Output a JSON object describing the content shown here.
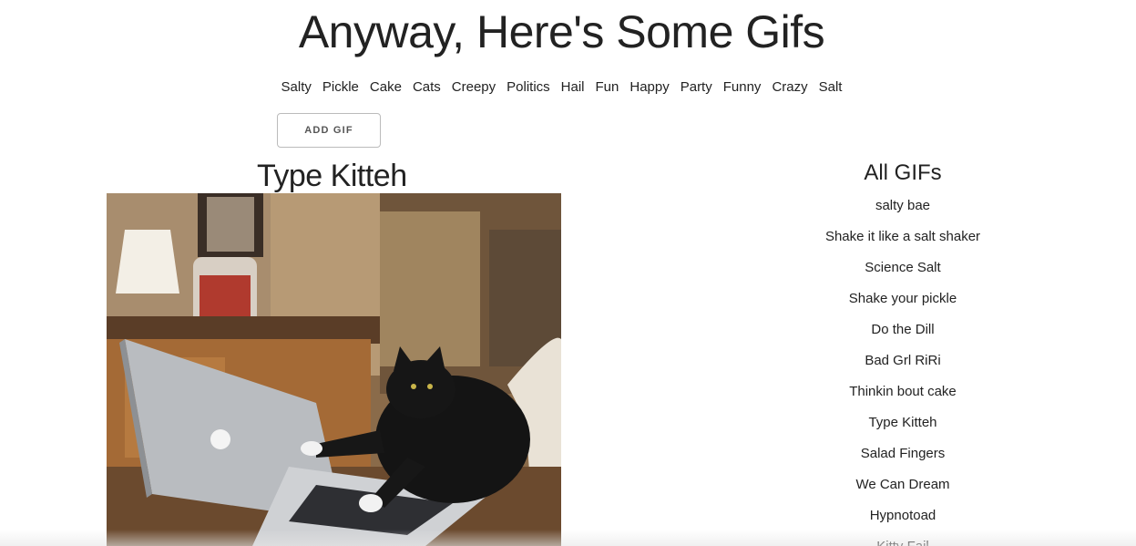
{
  "header": {
    "title": "Anyway, Here's Some Gifs"
  },
  "topics": [
    "Salty",
    "Pickle",
    "Cake",
    "Cats",
    "Creepy",
    "Politics",
    "Hail",
    "Fun",
    "Happy",
    "Party",
    "Funny",
    "Crazy",
    "Salt"
  ],
  "toolbar": {
    "add_gif_label": "ADD GIF"
  },
  "main": {
    "gif_title": "Type Kitteh",
    "gif_image_icon": "cat-typing-on-laptop-image"
  },
  "sidebar": {
    "title": "All GIFs",
    "items": [
      "salty bae",
      "Shake it like a salt shaker",
      "Science Salt",
      "Shake your pickle",
      "Do the Dill",
      "Bad Grl RiRi",
      "Thinkin bout cake",
      "Type Kitteh",
      "Salad Fingers",
      "We Can Dream",
      "Hypnotoad",
      "Kitty Fail"
    ]
  },
  "colors": {
    "text": "#222222",
    "button_border": "#bbbbbb",
    "background": "#ffffff"
  }
}
